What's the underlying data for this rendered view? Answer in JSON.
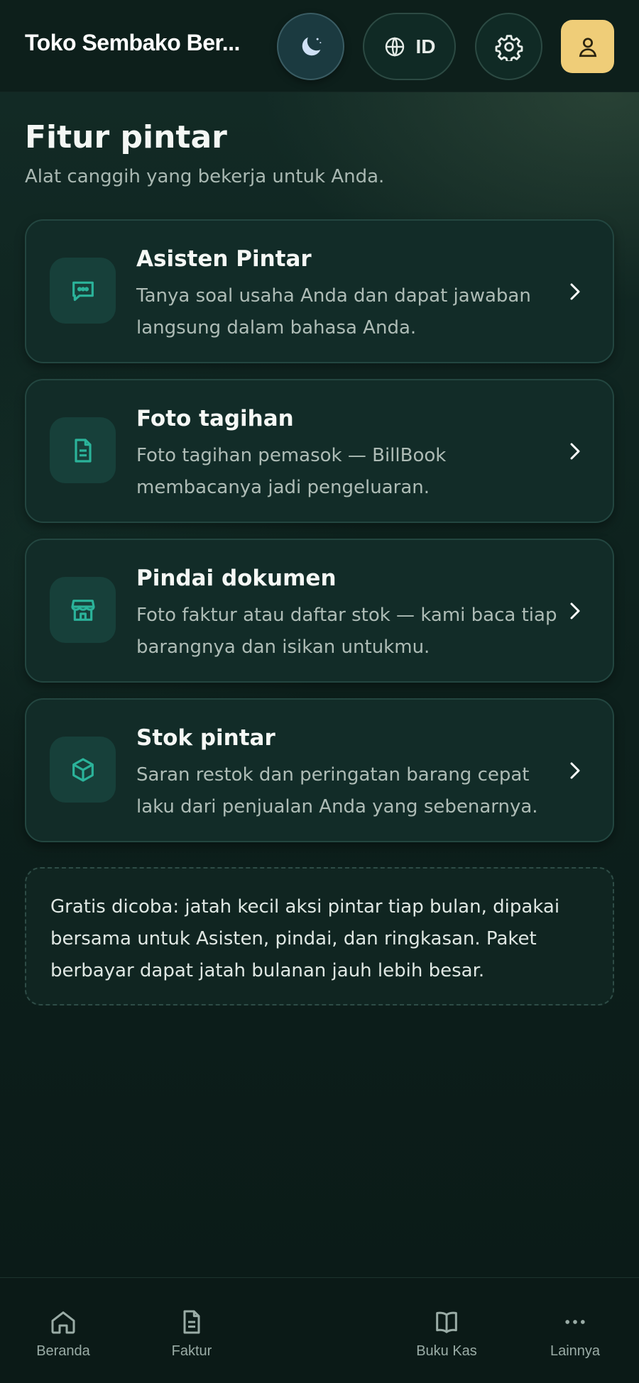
{
  "header": {
    "store_name": "Toko Sembako Ber...",
    "theme_icon": "moon-icon",
    "language_code": "ID",
    "language_icon": "globe-icon",
    "settings_icon": "gear-icon",
    "profile_icon": "user-icon"
  },
  "main": {
    "title": "Fitur pintar",
    "subtitle": "Alat canggih yang bekerja untuk Anda.",
    "features": [
      {
        "title": "Asisten Pintar",
        "description": "Tanya soal usaha Anda dan dapat jawaban langsung dalam bahasa Anda.",
        "icon": "chat-icon"
      },
      {
        "title": "Foto tagihan",
        "description": "Foto tagihan pemasok — BillBook membacanya jadi pengeluaran.",
        "icon": "document-icon"
      },
      {
        "title": "Pindai dokumen",
        "description": "Foto faktur atau daftar stok — kami baca tiap barangnya dan isikan untukmu.",
        "icon": "store-icon"
      },
      {
        "title": "Stok pintar",
        "description": "Saran restok dan peringatan barang cepat laku dari penjualan Anda yang sebenarnya.",
        "icon": "box-icon"
      }
    ],
    "notice": "Gratis dicoba: jatah kecil aksi pintar tiap bulan, dipakai bersama untuk Asisten, pindai, dan ringkasan. Paket berbayar dapat jatah bulanan jauh lebih besar."
  },
  "bottom_nav": [
    {
      "label": "Beranda",
      "icon": "home-icon"
    },
    {
      "label": "Faktur",
      "icon": "invoice-icon"
    },
    {
      "label": "Buku Kas",
      "icon": "book-icon"
    },
    {
      "label": "Lainnya",
      "icon": "more-icon"
    }
  ],
  "colors": {
    "accent": "#2bb39a",
    "profile_button": "#efcd78",
    "background": "#0c1d1a"
  }
}
